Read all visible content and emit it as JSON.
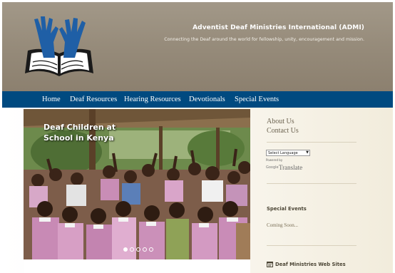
{
  "header": {
    "title": "Adventist Deaf Ministries International (ADMI)",
    "tagline": "Connecting the Deaf around the world for fellowship, unity, encouragement and mission."
  },
  "nav": {
    "items": [
      {
        "label": "Home"
      },
      {
        "label": "Deaf Resources"
      },
      {
        "label": "Hearing Resources"
      },
      {
        "label": "Devotionals"
      },
      {
        "label": "Special Events"
      }
    ]
  },
  "slider": {
    "caption": "Deaf Children at School in Kenya",
    "slide_count": 5,
    "active_slide": 1
  },
  "sidebar": {
    "links": [
      {
        "label": "About Us"
      },
      {
        "label": "Contact Us"
      }
    ],
    "translate": {
      "select_value": "Select Language",
      "powered_by": "Powered by",
      "google": "Google",
      "translate": "Translate"
    },
    "special_events": {
      "heading": "Special Events",
      "item": "Coming Soon..."
    },
    "web_sites": {
      "heading": "Deaf Ministries Web Sites"
    }
  },
  "colors": {
    "header": "#958a79",
    "nav": "#004a80",
    "sidebar_bg": "#f2ecdc",
    "logo_hands": "#1f5fa6"
  },
  "icons": [
    "adventist-deaf-logo",
    "chevron-down-icon",
    "web-sites-icon"
  ]
}
